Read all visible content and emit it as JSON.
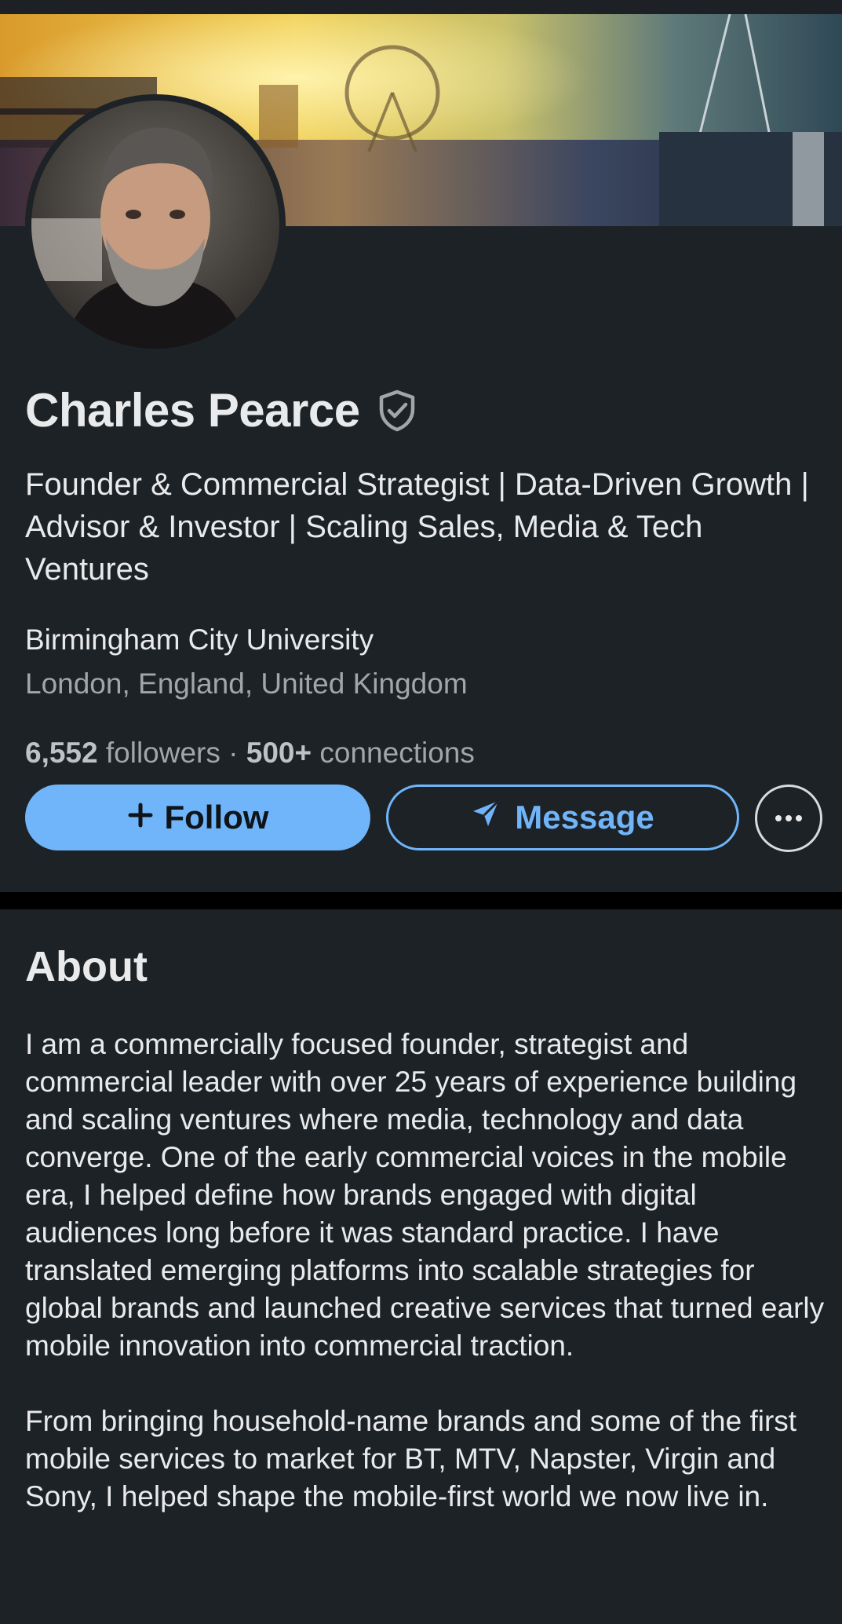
{
  "profile": {
    "name": "Charles Pearce",
    "headline": "Founder & Commercial Strategist | Data-Driven Growth | Advisor & Investor | Scaling Sales, Media & Tech Ventures",
    "school": "Birmingham City University",
    "location": "London, England, United Kingdom",
    "followers_count": "6,552",
    "followers_label": "followers",
    "separator": "·",
    "connections_count": "500+",
    "connections_label": "connections",
    "verified_icon": "shield-check-icon"
  },
  "actions": {
    "follow_label": "Follow",
    "follow_icon": "plus-icon",
    "message_label": "Message",
    "message_icon": "send-icon",
    "more_icon": "ellipsis-icon"
  },
  "about": {
    "title": "About",
    "paragraphs": [
      "I am a commercially focused founder, strategist and commercial leader with over 25 years of experience building and scaling ventures where media, technology and data converge. One of the early commercial voices in the mobile era, I helped define how brands engaged with digital audiences long before it was standard practice. I have translated emerging platforms into scalable strategies for global brands and launched creative services that turned early mobile innovation into commercial traction.",
      "From bringing household-name brands and some of the first mobile services to market for BT, MTV, Napster, Virgin and Sony, I helped shape the mobile-first world we now live in."
    ]
  },
  "colors": {
    "background": "#000000",
    "card": "#1d2226",
    "text_primary": "#e9eaeb",
    "text_secondary": "#a3a6a9",
    "accent": "#70b5f9"
  }
}
